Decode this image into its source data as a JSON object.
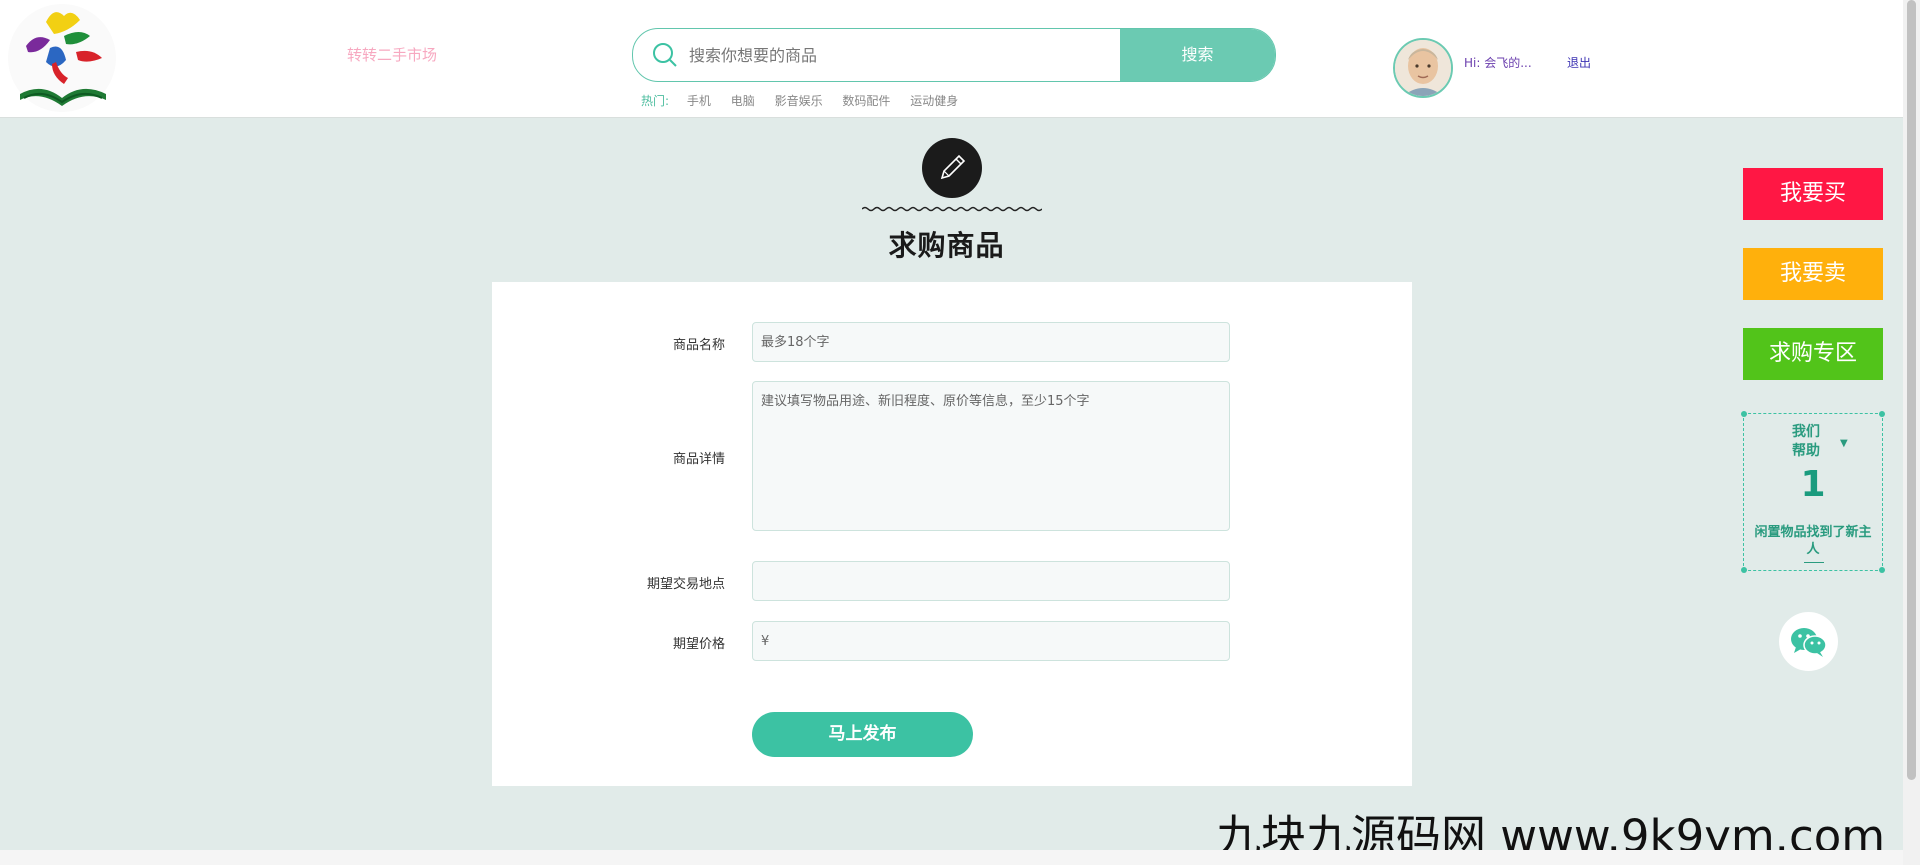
{
  "header": {
    "site_name": "转转二手市场",
    "search": {
      "placeholder": "搜索你想要的商品",
      "button_label": "搜索"
    },
    "hot": {
      "label": "热门:",
      "items": [
        "手机",
        "电脑",
        "影音娱乐",
        "数码配件",
        "运动健身"
      ]
    },
    "user": {
      "greeting": "Hi: 会飞的...",
      "logout_label": "退出"
    }
  },
  "page": {
    "title": "求购商品"
  },
  "form": {
    "name_label": "商品名称",
    "name_placeholder": "最多18个字",
    "detail_label": "商品详情",
    "detail_placeholder": "建议填写物品用途、新旧程度、原价等信息，至少15个字",
    "location_label": "期望交易地点",
    "location_value": "",
    "price_label": "期望价格",
    "price_value": "¥",
    "submit_label": "马上发布"
  },
  "side": {
    "buy_label": "我要买",
    "sell_label": "我要卖",
    "want_label": "求购专区",
    "help": {
      "line1": "我们",
      "line2": "帮助",
      "count": "1",
      "caption": "闲置物品找到了新主人"
    }
  },
  "watermark": "九块九源码网 www.9k9ym.com",
  "colors": {
    "accent": "#3cc2a3",
    "buy": "#ff1744",
    "sell": "#ffb00c",
    "want": "#52c41a",
    "background": "#e1ebe9"
  }
}
